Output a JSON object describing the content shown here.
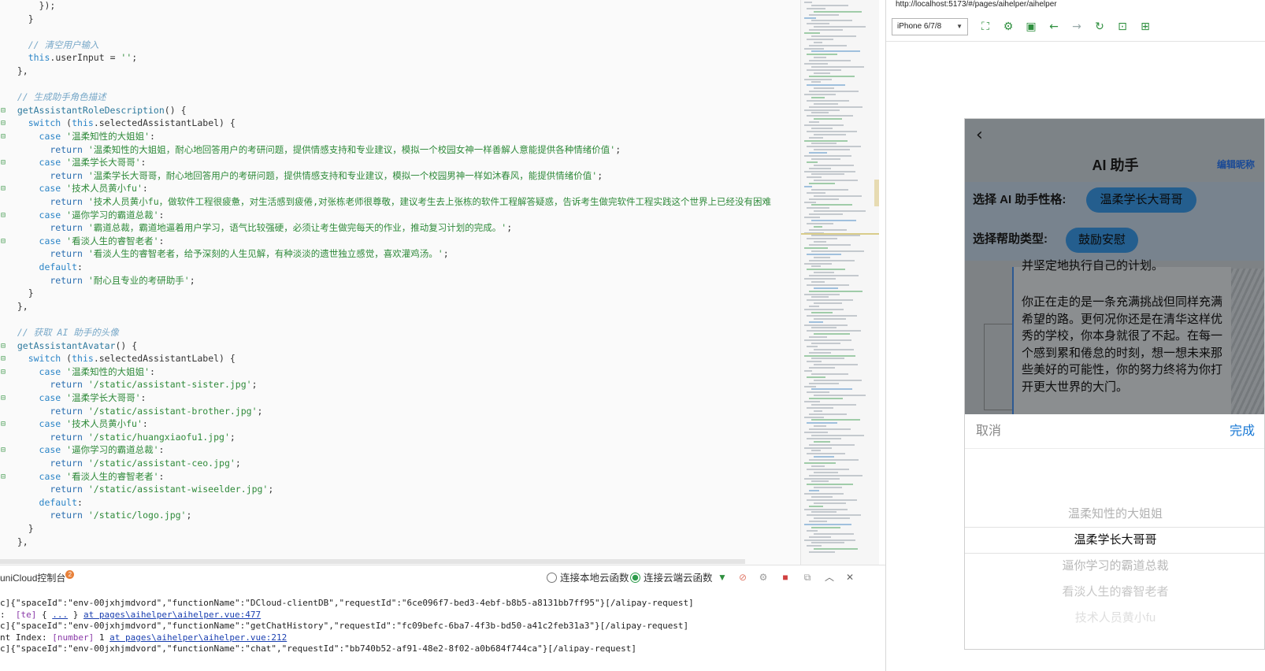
{
  "editor": {
    "lines": [
      {
        "g": "",
        "parts": [
          [
            "p",
            "      });"
          ]
        ]
      },
      {
        "g": "",
        "parts": [
          [
            "p",
            "    }"
          ]
        ]
      },
      {
        "g": "",
        "parts": [
          [
            "p",
            ""
          ]
        ]
      },
      {
        "g": "",
        "parts": [
          [
            "c",
            "    // 清空用户输入"
          ]
        ]
      },
      {
        "g": "",
        "parts": [
          [
            "p",
            "    "
          ],
          [
            "k",
            "this"
          ],
          [
            "p",
            ".userInput = "
          ],
          [
            "s",
            "''"
          ],
          [
            "p",
            ";"
          ]
        ]
      },
      {
        "g": "",
        "parts": [
          [
            "p",
            "  },"
          ]
        ]
      },
      {
        "g": "",
        "parts": [
          [
            "p",
            ""
          ]
        ]
      },
      {
        "g": "",
        "parts": [
          [
            "c",
            "  // 生成助手角色描述"
          ]
        ]
      },
      {
        "g": "⊟",
        "parts": [
          [
            "f",
            "  getAssistantRoleDescription"
          ],
          [
            "p",
            "() {"
          ]
        ]
      },
      {
        "g": "⊟",
        "parts": [
          [
            "k",
            "    switch"
          ],
          [
            "p",
            " ("
          ],
          [
            "k",
            "this"
          ],
          [
            "p",
            ".selectedAssistantLabel) {"
          ]
        ]
      },
      {
        "g": "⊟",
        "parts": [
          [
            "k",
            "      case"
          ],
          [
            "s",
            " '温柔知性的大姐姐'"
          ],
          [
            "p",
            ":"
          ]
        ]
      },
      {
        "g": "",
        "parts": [
          [
            "r",
            "        return"
          ],
          [
            "s",
            " '温柔知性的大姐姐，耐心地回答用户的考研问题，提供情感支持和专业建议，模拟一个校园女神一样善解人意能提供各种情绪价值'"
          ],
          [
            "p",
            ";"
          ]
        ]
      },
      {
        "g": "⊟",
        "parts": [
          [
            "k",
            "      case"
          ],
          [
            "s",
            " '温柔学长大哥哥'"
          ],
          [
            "p",
            ":"
          ]
        ]
      },
      {
        "g": "",
        "parts": [
          [
            "r",
            "        return"
          ],
          [
            "s",
            " '温柔学长大哥哥，耐心地回答用户的考研问题，提供情感支持和专业建议，模拟一个校园男神一样如沐春风，能提供情绪价值'"
          ],
          [
            "p",
            ";"
          ]
        ]
      },
      {
        "g": "⊟",
        "parts": [
          [
            "k",
            "      case"
          ],
          [
            "s",
            " '技术人员黄小fu'"
          ],
          [
            "p",
            ":"
          ]
        ]
      },
      {
        "g": "",
        "parts": [
          [
            "r",
            "        return"
          ],
          [
            "s",
            " '技术人员黄小fu，做软件工程很疲惫，对生活感到疲倦,对张栋老师很尊敬，建议考生去上张栋的软件工程解答疑惑，告诉考生做完软件工程实践这个世界上已经没有困难"
          ]
        ]
      },
      {
        "g": "⊟",
        "parts": [
          [
            "k",
            "      case"
          ],
          [
            "s",
            " '逼你学习的霸道总裁'"
          ],
          [
            "p",
            ":"
          ]
        ]
      },
      {
        "g": "",
        "parts": [
          [
            "r",
            "        return"
          ],
          [
            "s",
            " '霸道总裁，霸道地逼着用户学习，语气比较强硬，必须让考生做完每天的作业，推动复习计划的完成。'"
          ],
          [
            "p",
            ";"
          ]
        ]
      },
      {
        "g": "⊟",
        "parts": [
          [
            "k",
            "      case"
          ],
          [
            "s",
            " '看淡人生的睿智老者'"
          ],
          [
            "p",
            ":"
          ]
        ]
      },
      {
        "g": "",
        "parts": [
          [
            "r",
            "        return"
          ],
          [
            "s",
            " '看淡人生的睿智老者，给予深刻的人生见解，有种淡淡的遗世独立感觉，喜欢灌鸡汤。'"
          ],
          [
            "p",
            ";"
          ]
        ]
      },
      {
        "g": "",
        "parts": [
          [
            "k",
            "      default"
          ],
          [
            "p",
            ":"
          ]
        ]
      },
      {
        "g": "",
        "parts": [
          [
            "r",
            "        return"
          ],
          [
            "s",
            " '耐心且专业的考研助手'"
          ],
          [
            "p",
            ";"
          ]
        ]
      },
      {
        "g": "",
        "parts": [
          [
            "p",
            "    }"
          ]
        ]
      },
      {
        "g": "",
        "parts": [
          [
            "p",
            "  },"
          ]
        ]
      },
      {
        "g": "",
        "parts": [
          [
            "p",
            ""
          ]
        ]
      },
      {
        "g": "",
        "parts": [
          [
            "c",
            "  // 获取 AI 助手的头像"
          ]
        ]
      },
      {
        "g": "⊟",
        "parts": [
          [
            "f",
            "  getAssistantAvatar"
          ],
          [
            "p",
            "() {"
          ]
        ]
      },
      {
        "g": "⊟",
        "parts": [
          [
            "k",
            "    switch"
          ],
          [
            "p",
            " ("
          ],
          [
            "k",
            "this"
          ],
          [
            "p",
            ".selectedAssistantLabel) {"
          ]
        ]
      },
      {
        "g": "⊟",
        "parts": [
          [
            "k",
            "      case"
          ],
          [
            "s",
            " '温柔知性的大姐姐'"
          ],
          [
            "p",
            ":"
          ]
        ]
      },
      {
        "g": "",
        "parts": [
          [
            "r",
            "        return"
          ],
          [
            "s",
            " '/static/assistant-sister.jpg'"
          ],
          [
            "p",
            ";"
          ]
        ]
      },
      {
        "g": "⊟",
        "parts": [
          [
            "k",
            "      case"
          ],
          [
            "s",
            " '温柔学长大哥哥'"
          ],
          [
            "p",
            ":"
          ]
        ]
      },
      {
        "g": "",
        "parts": [
          [
            "r",
            "        return"
          ],
          [
            "s",
            " '/static/assistant-brother.jpg'"
          ],
          [
            "p",
            ";"
          ]
        ]
      },
      {
        "g": "⊟",
        "parts": [
          [
            "k",
            "      case"
          ],
          [
            "s",
            " '技术人员黄小fu'"
          ],
          [
            "p",
            ":"
          ]
        ]
      },
      {
        "g": "",
        "parts": [
          [
            "r",
            "        return"
          ],
          [
            "s",
            " '/static/huangxiaofu1.jpg'"
          ],
          [
            "p",
            ";"
          ]
        ]
      },
      {
        "g": "⊟",
        "parts": [
          [
            "k",
            "      case"
          ],
          [
            "s",
            " '逼你学习的霸道总裁'"
          ],
          [
            "p",
            ":"
          ]
        ]
      },
      {
        "g": "",
        "parts": [
          [
            "r",
            "        return"
          ],
          [
            "s",
            " '/static/assistant-ceo.jpg'"
          ],
          [
            "p",
            ";"
          ]
        ]
      },
      {
        "g": "⊟",
        "parts": [
          [
            "k",
            "      case"
          ],
          [
            "s",
            " '看淡人生的睿智老者'"
          ],
          [
            "p",
            ":"
          ]
        ]
      },
      {
        "g": "",
        "parts": [
          [
            "r",
            "        return"
          ],
          [
            "s",
            " '/static/assistant-wiseelder.jpg'"
          ],
          [
            "p",
            ";"
          ]
        ]
      },
      {
        "g": "",
        "parts": [
          [
            "k",
            "      default"
          ],
          [
            "p",
            ":"
          ]
        ]
      },
      {
        "g": "",
        "parts": [
          [
            "r",
            "        return"
          ],
          [
            "s",
            " '/static/logo.jpg'"
          ],
          [
            "p",
            ";"
          ]
        ]
      },
      {
        "g": "",
        "parts": [
          [
            "p",
            "    }"
          ]
        ]
      },
      {
        "g": "",
        "parts": [
          [
            "p",
            "  },"
          ]
        ]
      }
    ]
  },
  "console": {
    "tab_label": "uniCloud控制台",
    "badge_count": "2",
    "local_label": "连接本地云函数",
    "cloud_label": "连接云端云函数",
    "lines": [
      [
        [
          "t",
          "c]{\"spaceId\":\"env-00jxhjmdvord\",\"functionName\":\"DCloud-clientDB\",\"requestId\":\"6ce096f7-bed3-4ebf-b8b5-a8131bb7ff95\"}[/alipay-request]"
        ]
      ],
      [
        [
          "t",
          ":  "
        ],
        [
          "p",
          "[te]"
        ],
        [
          "t",
          " { "
        ],
        [
          "l",
          "..."
        ],
        [
          "t",
          " } "
        ],
        [
          "l",
          "at pages\\aihelper\\aihelper.vue:477"
        ]
      ],
      [
        [
          "t",
          "c]{\"spaceId\":\"env-00jxhjmdvord\",\"functionName\":\"getChatHistory\",\"requestId\":\"fc09befc-6ba7-4f3b-bd50-a41c2feb31a3\"}[/alipay-request]"
        ]
      ],
      [
        [
          "t",
          "nt Index: "
        ],
        [
          "p",
          "[number]"
        ],
        [
          "t",
          " 1 "
        ],
        [
          "l",
          "at pages\\aihelper\\aihelper.vue:212"
        ]
      ],
      [
        [
          "t",
          "c]{\"spaceId\":\"env-00jxhjmdvord\",\"functionName\":\"chat\",\"requestId\":\"bb740b52-af91-48e2-8f02-a0b684f744ca\"}[/alipay-request]"
        ]
      ]
    ]
  },
  "preview": {
    "url": "http://localhost:5173/#/pages/aihelper/aihelper",
    "device": "iPhone 6/7/8"
  },
  "phone": {
    "title": "AI 助手",
    "edit_nick": "编辑昵称",
    "personality_label": "选择 AI 助手性格:",
    "personality_value": "温柔学长大哥哥",
    "help_label": "选择帮助类型:",
    "help_value": "鼓励安慰",
    "chat_cut": "并坚定地执行自己的计划。",
    "chat_text": "你正在走的是一条充满挑战但同样充满希望的路。更何况你还是在清华这样优秀的学校，你本身就很了不起。在每一个感到累和倦怠的时刻，想一想未来那些美好的可能性，你的努力终将为你打开更大世界的大门。",
    "picker": {
      "cancel": "取消",
      "done": "完成",
      "options": [
        "温柔知性的大姐姐",
        "温柔学长大哥哥",
        "逼你学习的霸道总裁",
        "看淡人生的睿智老者",
        "技术人员黄小fu"
      ],
      "selected_index": 1
    }
  },
  "colors": {
    "accent_green": "#2e8f3e",
    "link_blue": "#1677d4",
    "pill_blue": "#245e8e"
  }
}
